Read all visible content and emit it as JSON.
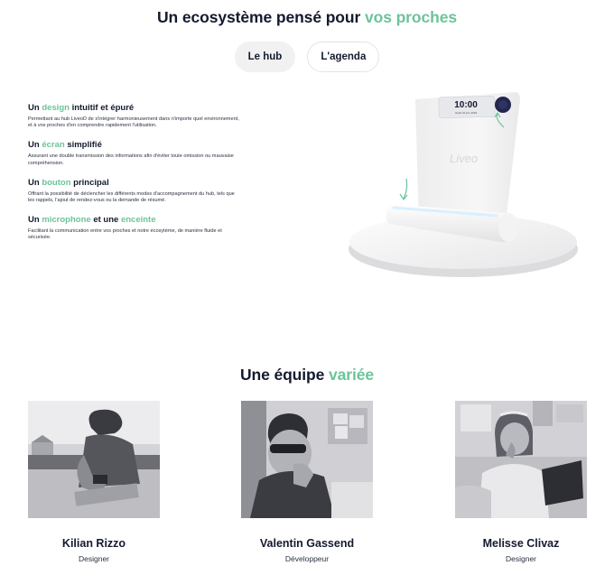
{
  "ecosystem": {
    "title_main": "Un ecosystème pensé pour",
    "title_accent": "vos proches",
    "tabs": [
      {
        "label": "Le hub",
        "active": true
      },
      {
        "label": "L'agenda",
        "active": false
      }
    ],
    "features": [
      {
        "pre": "Un",
        "accent": "design",
        "post": "intuitif et épuré",
        "text": "Permettant au hub LiveoD de s'intégrer harmonieusement dans n'importe quel environnement, et à vos proches d'en comprendre rapidement l'utilisation."
      },
      {
        "pre": "Un",
        "accent": "écran",
        "post": "simplifié",
        "text": "Assurant une double transmission des informations afin d'éviter toute omission ou mauvaise compréhension."
      },
      {
        "pre": "Un",
        "accent": "bouton",
        "post": "principal",
        "text": "Offrant la possibilité de déclencher les différents modes d'accompagnement du hub, tels que les rappels, l'ajout de rendez-vous ou la demande de résumé."
      },
      {
        "pre": "Un",
        "accent": "microphone",
        "mid": "et une",
        "accent2": "enceinte",
        "text": "Facilitant la communication entre vos proches et notre écosytème, de manière fluide et sécurisée."
      }
    ],
    "device": {
      "time": "10:00",
      "date": "Jeudi 22 juin 2023",
      "brand": "Liveo"
    }
  },
  "team": {
    "title_main": "Une équipe",
    "title_accent": "variée",
    "members": [
      {
        "name": "Kilian Rizzo",
        "role": "Designer"
      },
      {
        "name": "Valentin Gassend",
        "role": "Développeur"
      },
      {
        "name": "Melisse Clivaz",
        "role": "Designer"
      }
    ]
  },
  "colors": {
    "accent": "#6cc49a",
    "text": "#141a2e",
    "tab_bg": "#f1f1f2"
  }
}
